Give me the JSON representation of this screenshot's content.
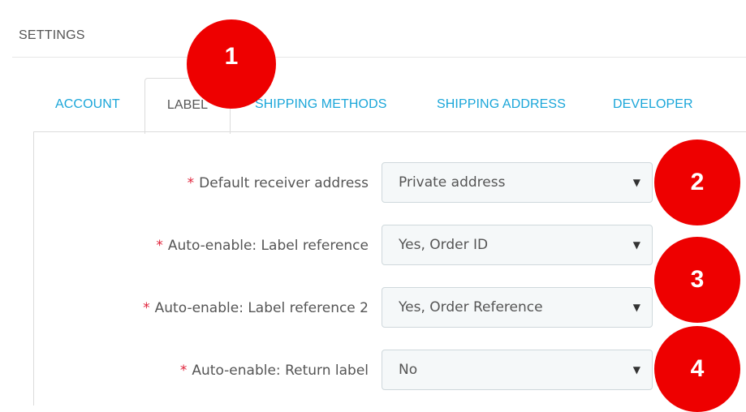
{
  "header": {
    "title": "SETTINGS"
  },
  "tabs": [
    {
      "label": "ACCOUNT"
    },
    {
      "label": "LABEL"
    },
    {
      "label": "SHIPPING METHODS"
    },
    {
      "label": "SHIPPING ADDRESS"
    },
    {
      "label": "DEVELOPER"
    }
  ],
  "active_tab": "LABEL",
  "required_marker": "*",
  "form": {
    "fields": [
      {
        "label": "Default receiver address",
        "value": "Private address"
      },
      {
        "label": "Auto-enable: Label reference",
        "value": "Yes, Order ID"
      },
      {
        "label": "Auto-enable: Label reference 2",
        "value": "Yes, Order Reference"
      },
      {
        "label": "Auto-enable: Return label",
        "value": "No"
      }
    ]
  },
  "callouts": [
    {
      "number": "1"
    },
    {
      "number": "2"
    },
    {
      "number": "3"
    },
    {
      "number": "4"
    }
  ],
  "colors": {
    "accent": "#1aa6d9",
    "required": "#e0223a",
    "callout": "#ee0000"
  },
  "icons": {
    "select_caret": "chevron-down-icon"
  }
}
